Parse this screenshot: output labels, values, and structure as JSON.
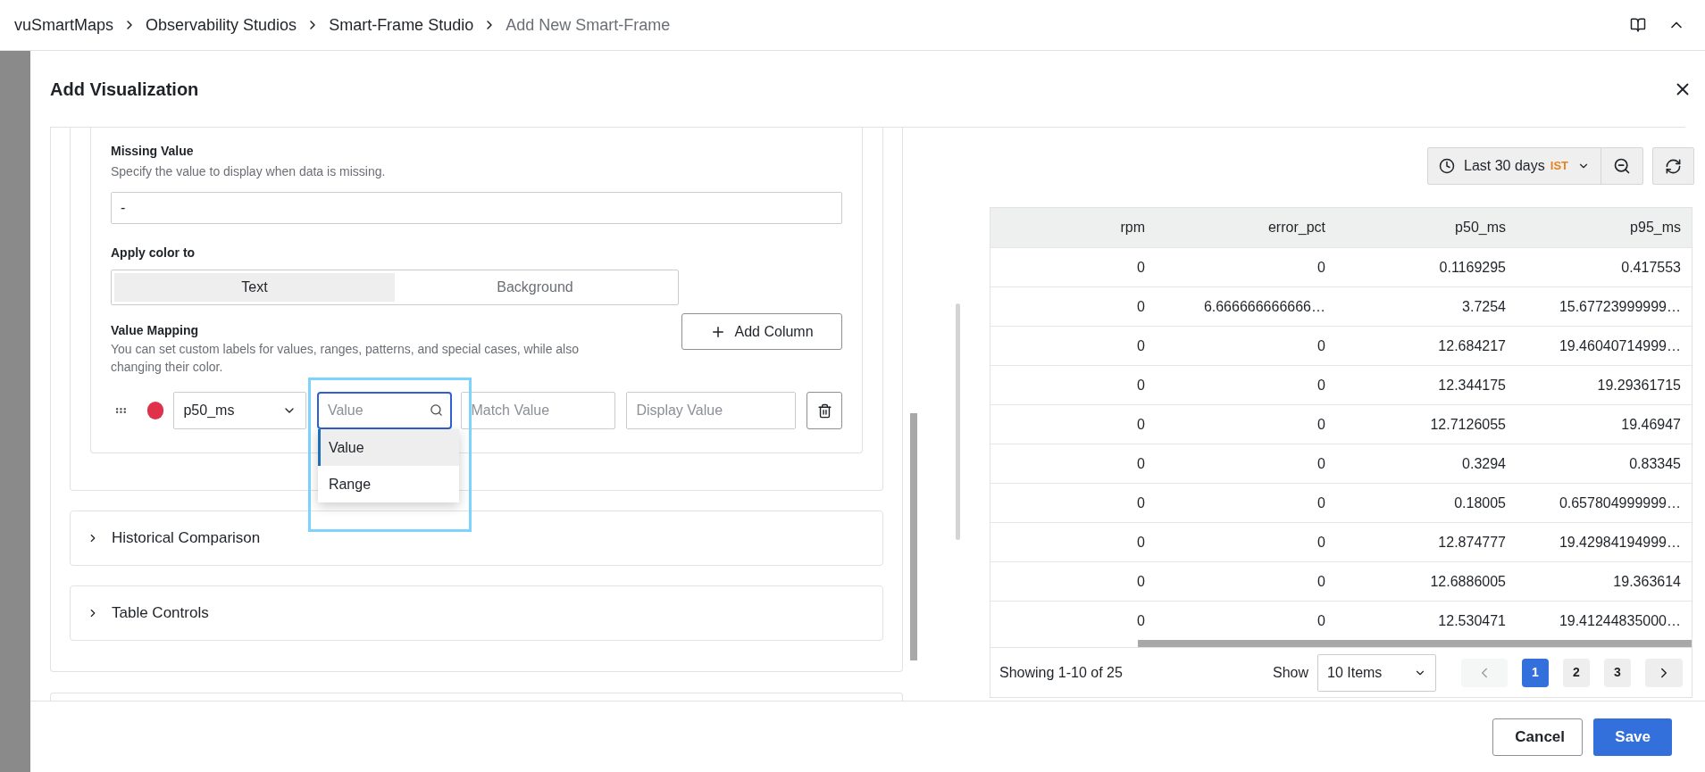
{
  "breadcrumb": {
    "items": [
      {
        "label": "vuSmartMaps",
        "current": false
      },
      {
        "label": "Observability Studios",
        "current": false
      },
      {
        "label": "Smart-Frame Studio",
        "current": false
      },
      {
        "label": "Add New Smart-Frame",
        "current": true
      }
    ]
  },
  "dialog": {
    "title": "Add Visualization"
  },
  "missing_value": {
    "label": "Missing Value",
    "description": "Specify the value to display when data is missing.",
    "value": "-"
  },
  "apply_color": {
    "label": "Apply color to",
    "options": [
      {
        "label": "Text",
        "selected": true
      },
      {
        "label": "Background",
        "selected": false
      }
    ]
  },
  "value_mapping": {
    "label": "Value Mapping",
    "description": "You can set custom labels for values, ranges, patterns, and special cases, while also changing their color.",
    "add_button": "Add Column",
    "row": {
      "color": "#e0314b",
      "column": "p50_ms",
      "search_placeholder": "Value",
      "match_placeholder": "Match Value",
      "display_placeholder": "Display Value"
    },
    "menu": [
      {
        "label": "Value",
        "selected": true
      },
      {
        "label": "Range",
        "selected": false
      }
    ]
  },
  "sections": [
    {
      "label": "Historical Comparison",
      "expanded": false
    },
    {
      "label": "Table Controls",
      "expanded": false
    }
  ],
  "time_range": {
    "label": "Last 30 days",
    "zone": "IST"
  },
  "table": {
    "columns": [
      "rpm",
      "error_pct",
      "p50_ms",
      "p95_ms"
    ],
    "rows": [
      [
        "0",
        "0",
        "0.1169295",
        "0.417553"
      ],
      [
        "0",
        "6.666666666666…",
        "3.7254",
        "15.67723999999…"
      ],
      [
        "0",
        "0",
        "12.684217",
        "19.46040714999…"
      ],
      [
        "0",
        "0",
        "12.344175",
        "19.29361715"
      ],
      [
        "0",
        "0",
        "12.7126055",
        "19.46947"
      ],
      [
        "0",
        "0",
        "0.3294",
        "0.83345"
      ],
      [
        "0",
        "0",
        "0.18005",
        "0.657804999999…"
      ],
      [
        "0",
        "0",
        "12.874777",
        "19.42984194999…"
      ],
      [
        "0",
        "0",
        "12.6886005",
        "19.363614"
      ],
      [
        "0",
        "0",
        "12.530471",
        "19.41244835000…"
      ]
    ]
  },
  "pagination": {
    "summary": "Showing 1-10 of 25",
    "show_label": "Show",
    "page_size": "10 Items",
    "prev_disabled": true,
    "pages": [
      {
        "label": "1",
        "selected": true
      },
      {
        "label": "2",
        "selected": false
      },
      {
        "label": "3",
        "selected": false
      }
    ]
  },
  "buttons": [
    {
      "label": "Cancel",
      "kind": "secondary"
    },
    {
      "label": "Save",
      "kind": "primary"
    }
  ]
}
